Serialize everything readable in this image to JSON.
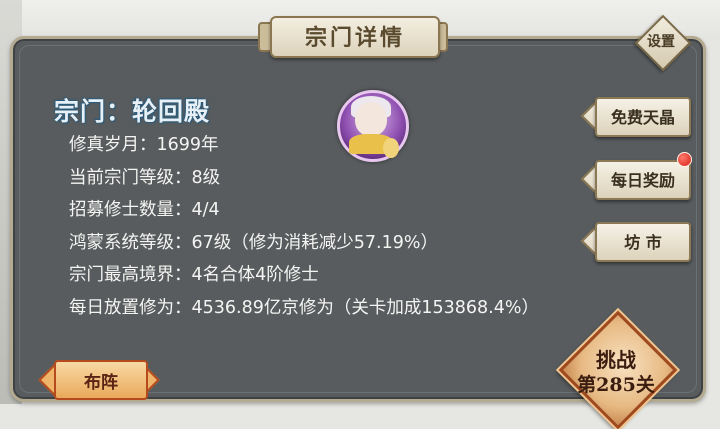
{
  "title": "宗门详情",
  "settings_label": "设置",
  "sect": {
    "name": "宗门：轮回殿",
    "info": [
      "修真岁月：1699年",
      "当前宗门等级：8级",
      "招募修士数量：4/4",
      "鸿蒙系统等级：67级（修为消耗减少57.19%）",
      "宗门最高境界：4名合体4阶修士",
      "每日放置修为：4536.89亿京修为（关卡加成153868.4%）"
    ]
  },
  "side_buttons": {
    "free_crystal": "免费天晶",
    "daily_reward": "每日奖励",
    "market": "坊 市"
  },
  "formation_label": "布阵",
  "challenge": {
    "label": "挑战",
    "stage": "第285关"
  },
  "colors": {
    "panel": "#585c5e",
    "notification_dot": "#d41f16",
    "challenge_border": "#a0491f"
  }
}
